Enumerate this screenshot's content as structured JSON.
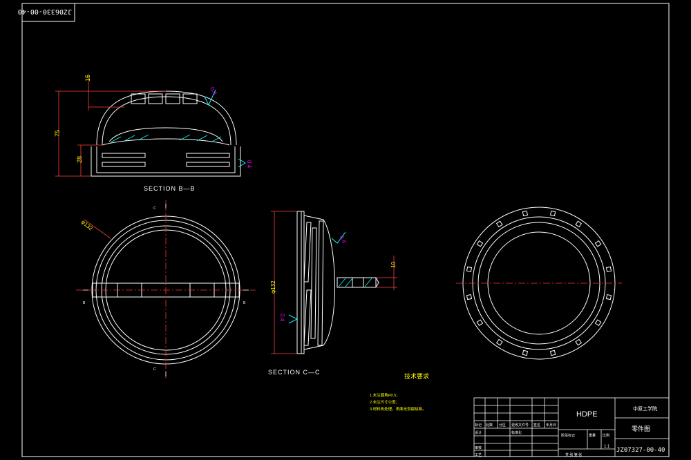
{
  "drawing_number_top": "JZ06330-00-40",
  "drawing_number_bottom": "JZ07327-00-40",
  "views": {
    "section_bb": "SECTION B—B",
    "section_cc": "SECTION C—C"
  },
  "dims": {
    "d15": "15",
    "d75": "75",
    "d28": "28",
    "d10": "10",
    "phi132_a": "φ132",
    "phi132_b": "φ132",
    "roughness": "0.4"
  },
  "markers": {
    "b": "B",
    "c": "C"
  },
  "tech_req": {
    "title": "技术要求",
    "items": [
      "1.未注圆角R0.5；",
      "2.未注尺寸公差；",
      "3.材料热处理，表面无划痕缺陷。"
    ]
  },
  "title_block": {
    "material": "HDPE",
    "company": "中原工学院",
    "drawing_name": "零件图",
    "scale": "1:1",
    "rows": {
      "r1": [
        "标记",
        "处数",
        "分区",
        "更改文件号",
        "签名",
        "年月日"
      ],
      "r2": [
        "设计",
        "标准化"
      ],
      "r3": [
        "审核"
      ],
      "r4": [
        "工艺"
      ],
      "stage": "阶段标记",
      "weight": "重量",
      "ratio": "比例",
      "sheets": "共   张   第   张"
    }
  },
  "colors": {
    "line": "#ffffff",
    "center": "#ff3030",
    "dim": "#ffff00",
    "mark": "#ff00ff",
    "hatch": "#00ffff",
    "dimline": "#ff4040"
  }
}
